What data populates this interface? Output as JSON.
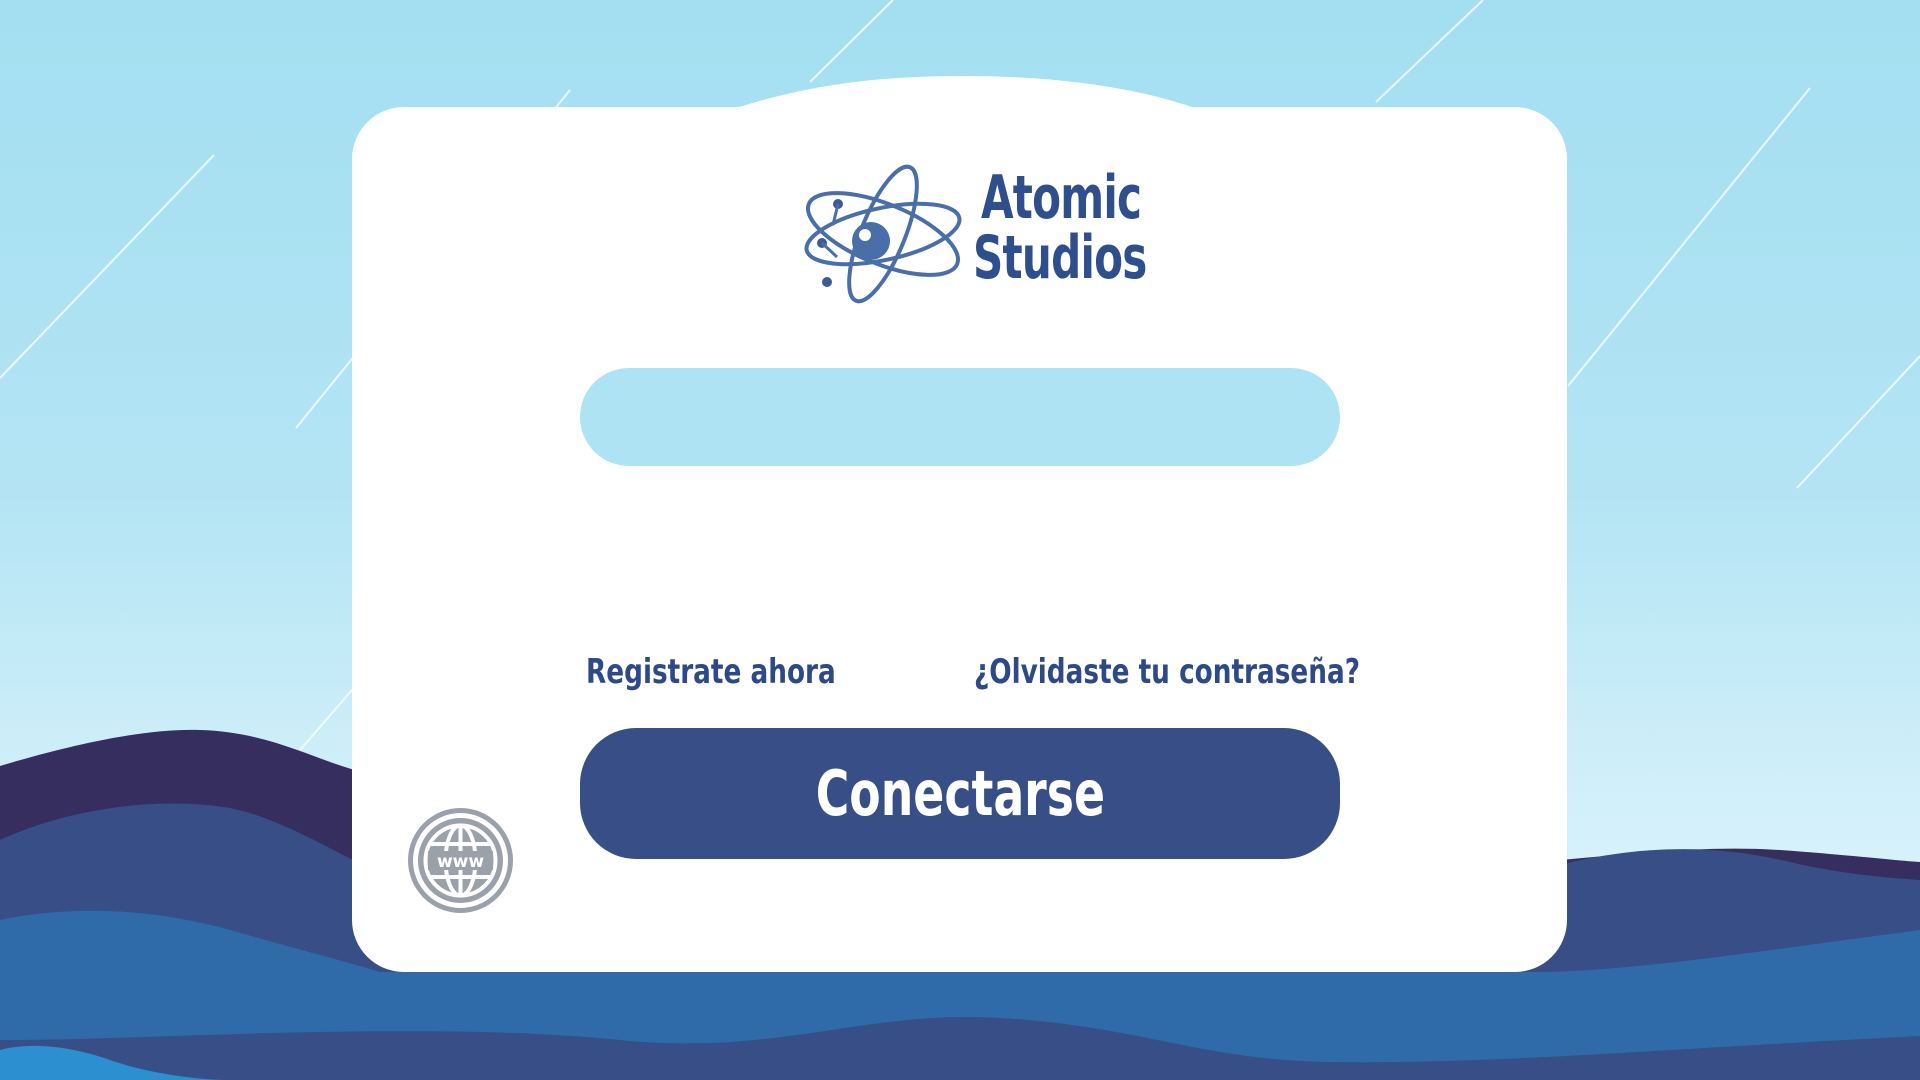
{
  "brand": {
    "line1": "Atomic",
    "line2": "Studios"
  },
  "login": {
    "username_value": "",
    "username_placeholder": "",
    "register_label": "Registrate ahora",
    "forgot_label": "¿Olvidaste tu contraseña?",
    "connect_label": "Conectarse"
  },
  "icons": {
    "logo": "atom-logo-icon",
    "language": "globe-www-icon"
  },
  "colors": {
    "sky": "#a3dff1",
    "brand_blue": "#374f86",
    "input_fill": "#ade3f2",
    "globe_gray": "#9ba1ab"
  }
}
